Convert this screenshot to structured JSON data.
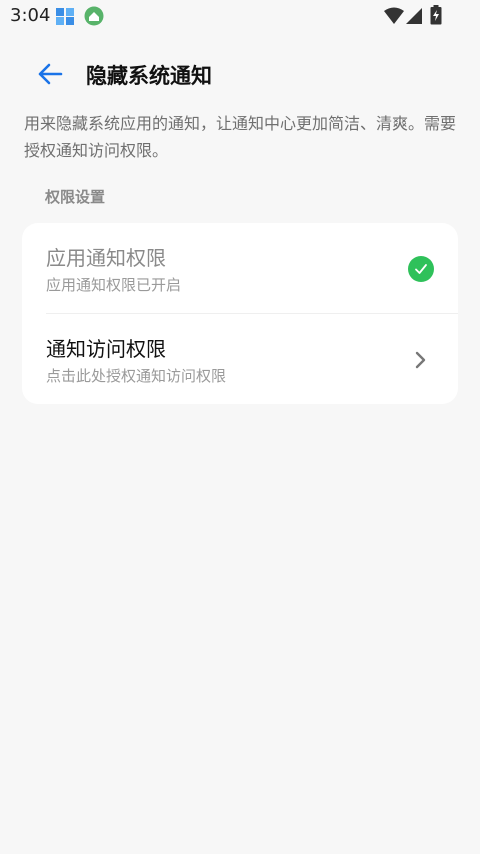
{
  "status_bar": {
    "time": "3:04",
    "icons": [
      "app-notification-icon",
      "app-notification-2-icon",
      "wifi-icon",
      "signal-icon",
      "battery-charging-icon"
    ]
  },
  "header": {
    "title": "隐藏系统通知",
    "back_icon": "arrow-left-icon"
  },
  "description": "用来隐藏系统应用的通知，让通知中心更加简洁、清爽。需要授权通知访问权限。",
  "section_title": "权限设置",
  "permissions": [
    {
      "title": "应用通知权限",
      "subtitle": "应用通知权限已开启",
      "status_icon": "check-circle-icon"
    },
    {
      "title": "通知访问权限",
      "subtitle": "点击此处授权通知访问权限",
      "status_icon": "chevron-right-icon"
    }
  ],
  "colors": {
    "background": "#f7f7f7",
    "accent_blue": "#1a73e8",
    "success_green": "#2fc15a"
  }
}
